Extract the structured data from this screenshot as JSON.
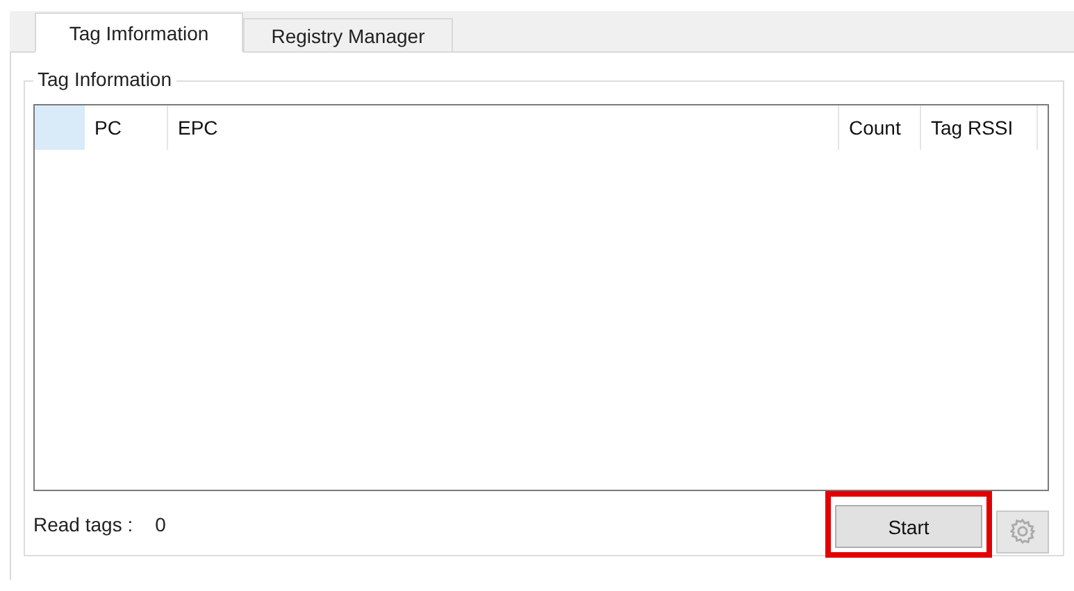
{
  "tabs": [
    {
      "label": "Tag Imformation",
      "selected": true
    },
    {
      "label": "Registry Manager",
      "selected": false
    }
  ],
  "group": {
    "title": "Tag Information"
  },
  "table": {
    "columns": [
      "PC",
      "EPC",
      "Count",
      "Tag RSSI"
    ]
  },
  "footer": {
    "label": "Read tags :",
    "value": "0"
  },
  "start_button": {
    "label": "Start",
    "highlighted": true
  }
}
